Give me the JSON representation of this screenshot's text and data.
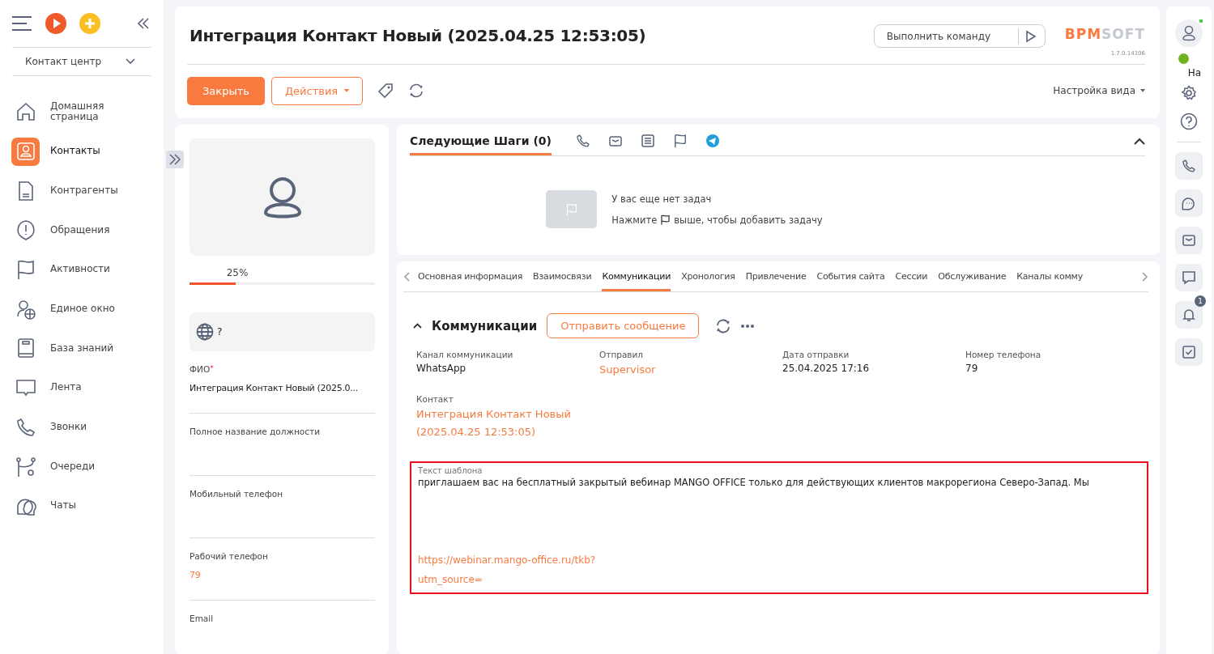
{
  "sidebar": {
    "workplace": "Контакт центр",
    "items": [
      {
        "label": "Домашняя страница",
        "selected": false
      },
      {
        "label": "Контакты",
        "selected": true
      },
      {
        "label": "Контрагенты",
        "selected": false
      },
      {
        "label": "Обращения",
        "selected": false
      },
      {
        "label": "Активности",
        "selected": false
      },
      {
        "label": "Единое окно",
        "selected": false
      },
      {
        "label": "База знаний",
        "selected": false
      },
      {
        "label": "Лента",
        "selected": false
      },
      {
        "label": "Звонки",
        "selected": false
      },
      {
        "label": "Очереди",
        "selected": false
      },
      {
        "label": "Чаты",
        "selected": false
      }
    ]
  },
  "header": {
    "title": "Интеграция Контакт Новый (2025.04.25 12:53:05)",
    "command_placeholder": "Выполнить команду",
    "logo": {
      "accent": "BPM",
      "rest": "SOFT"
    },
    "version": "1.7.0.14106",
    "close_button": "Закрыть",
    "actions_button": "Действия",
    "view_settings": "Настройка вида"
  },
  "profile": {
    "level": 0.25,
    "completeness": "25%",
    "timezone": "?",
    "fields": [
      {
        "label": "ФИО",
        "required_mark": "*",
        "value": "Интеграция Контакт Новый (2025.0...",
        "kind": "text"
      },
      {
        "label": "Полное название должности"
      },
      {
        "label": "Мобильный телефон"
      },
      {
        "label": "Рабочий телефон",
        "value": "79",
        "kind": "link"
      },
      {
        "label": "Email"
      }
    ]
  },
  "next_steps": {
    "title": "Следующие Шаги (0)",
    "selected": true,
    "empty_title": "У вас еще нет задач",
    "hint_before": "Нажмите",
    "hint_after": "выше, чтобы добавить задачу"
  },
  "tabs": [
    {
      "label": "Основная информация",
      "selected": false
    },
    {
      "label": "Взаимосвязи",
      "selected": false
    },
    {
      "label": "Коммуникации",
      "selected": true
    },
    {
      "label": "Хронология",
      "selected": false
    },
    {
      "label": "Привлечение",
      "selected": false
    },
    {
      "label": "События сайта",
      "selected": false
    },
    {
      "label": "Сессии",
      "selected": false
    },
    {
      "label": "Обслуживание",
      "selected": false
    },
    {
      "label": "Каналы комму",
      "selected": false
    }
  ],
  "communications": {
    "title": "Коммуникации",
    "send_button": "Отправить сообщение",
    "fields": [
      {
        "label": "Канал коммуникации",
        "value": "WhatsApp",
        "kind": "text"
      },
      {
        "label": "Отправил",
        "value": "Supervisor",
        "kind": "link"
      },
      {
        "label": "Дата отправки",
        "value": "25.04.2025 17:16",
        "kind": "text"
      },
      {
        "label": "Номер телефона",
        "value": "79",
        "kind": "text"
      },
      {
        "label": "Контакт",
        "value": "Интеграция Контакт Новый (2025.04.25 12:53:05)",
        "kind": "link"
      }
    ],
    "template_label": "Текст шаблона",
    "template_text": "приглашаем вас на бесплатный закрытый вебинар MANGO OFFICE только для действующих клиентов макрорегиона Северо-Запад. Мы",
    "template_link": "https://webinar.mango-office.ru/tkb?",
    "template_link_tail": "utm_source="
  },
  "right_rail": {
    "status_label": "На",
    "notifications": "1"
  }
}
